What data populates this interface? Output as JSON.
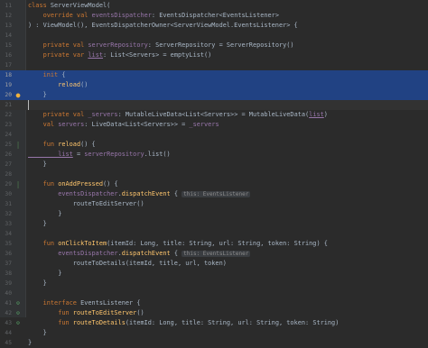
{
  "editor": {
    "lines": [
      {
        "num": "11",
        "mark": "",
        "sel": false,
        "tokens": [
          [
            "kw",
            "class "
          ],
          [
            "cl",
            "ServerViewModel"
          ],
          [
            "pl",
            "("
          ]
        ]
      },
      {
        "num": "12",
        "mark": "",
        "sel": false,
        "tokens": [
          [
            "kw",
            "    override val "
          ],
          [
            "pr",
            "eventsDispatcher"
          ],
          [
            "pl",
            ": EventsDispatcher<EventsListener>"
          ]
        ]
      },
      {
        "num": "13",
        "mark": "",
        "sel": false,
        "tokens": [
          [
            "pl",
            ") : ViewModel(), EventsDispatcherOwner<ServerViewModel.EventsListener> {"
          ]
        ]
      },
      {
        "num": "14",
        "mark": "",
        "sel": false,
        "tokens": []
      },
      {
        "num": "15",
        "mark": "",
        "sel": false,
        "tokens": [
          [
            "kw",
            "    private val "
          ],
          [
            "pr",
            "serverRepository"
          ],
          [
            "pl",
            ": ServerRepository = ServerRepository()"
          ]
        ]
      },
      {
        "num": "16",
        "mark": "",
        "sel": false,
        "tokens": [
          [
            "kw",
            "    private var "
          ],
          [
            "pr ul",
            "list"
          ],
          [
            "pl",
            ": List<Servers> = emptyList()"
          ]
        ]
      },
      {
        "num": "17",
        "mark": "",
        "sel": false,
        "tokens": []
      },
      {
        "num": "18",
        "mark": "",
        "sel": true,
        "tokens": [
          [
            "kw",
            "    init "
          ],
          [
            "pl",
            "{"
          ]
        ]
      },
      {
        "num": "19",
        "mark": "",
        "sel": true,
        "tokens": [
          [
            "fn",
            "        reload"
          ],
          [
            "pl",
            "()"
          ]
        ]
      },
      {
        "num": "20",
        "mark": "bulb",
        "sel": true,
        "tokens": [
          [
            "pl",
            "    }"
          ]
        ]
      },
      {
        "num": "21",
        "mark": "",
        "sel": false,
        "cur": true,
        "tokens": []
      },
      {
        "num": "22",
        "mark": "",
        "sel": false,
        "tokens": [
          [
            "kw",
            "    private val "
          ],
          [
            "pr",
            "_servers"
          ],
          [
            "pl",
            ": MutableLiveData<List<Servers>> = MutableLiveData("
          ],
          [
            "pr ul",
            "list"
          ],
          [
            "pl",
            ")"
          ]
        ]
      },
      {
        "num": "23",
        "mark": "",
        "sel": false,
        "tokens": [
          [
            "kw",
            "    val "
          ],
          [
            "pr",
            "servers"
          ],
          [
            "pl",
            ": LiveData<List<Servers>> = "
          ],
          [
            "pr",
            "_servers"
          ]
        ]
      },
      {
        "num": "24",
        "mark": "",
        "sel": false,
        "tokens": []
      },
      {
        "num": "25",
        "mark": "mod",
        "sel": false,
        "tokens": [
          [
            "kw",
            "    fun "
          ],
          [
            "fn",
            "reload"
          ],
          [
            "pl",
            "() {"
          ]
        ]
      },
      {
        "num": "26",
        "mark": "",
        "sel": false,
        "tokens": [
          [
            "pr ul",
            "        list"
          ],
          [
            "pl",
            " = "
          ],
          [
            "pr",
            "serverRepository"
          ],
          [
            "pl",
            ".list()"
          ]
        ]
      },
      {
        "num": "27",
        "mark": "",
        "sel": false,
        "tokens": [
          [
            "pl",
            "    }"
          ]
        ]
      },
      {
        "num": "28",
        "mark": "",
        "sel": false,
        "tokens": []
      },
      {
        "num": "29",
        "mark": "mod",
        "sel": false,
        "tokens": [
          [
            "kw",
            "    fun "
          ],
          [
            "fn",
            "onAddPressed"
          ],
          [
            "pl",
            "() {"
          ]
        ]
      },
      {
        "num": "30",
        "mark": "",
        "sel": false,
        "tokens": [
          [
            "pr",
            "        eventsDispatcher"
          ],
          [
            "pl",
            "."
          ],
          [
            "fn",
            "dispatchEvent"
          ],
          [
            "pl",
            " { "
          ],
          [
            "hint",
            "this: EventsListener"
          ]
        ]
      },
      {
        "num": "31",
        "mark": "",
        "sel": false,
        "tokens": [
          [
            "pl",
            "            routeToEditServer()"
          ]
        ]
      },
      {
        "num": "32",
        "mark": "",
        "sel": false,
        "tokens": [
          [
            "pl",
            "        }"
          ]
        ]
      },
      {
        "num": "33",
        "mark": "",
        "sel": false,
        "tokens": [
          [
            "pl",
            "    }"
          ]
        ]
      },
      {
        "num": "34",
        "mark": "",
        "sel": false,
        "tokens": []
      },
      {
        "num": "35",
        "mark": "",
        "sel": false,
        "tokens": [
          [
            "kw",
            "    fun "
          ],
          [
            "fn",
            "onClickToItem"
          ],
          [
            "pl",
            "(itemId: Long, title: String, url: String, token: String) {"
          ]
        ]
      },
      {
        "num": "36",
        "mark": "",
        "sel": false,
        "tokens": [
          [
            "pr",
            "        eventsDispatcher"
          ],
          [
            "pl",
            "."
          ],
          [
            "fn",
            "dispatchEvent"
          ],
          [
            "pl",
            " { "
          ],
          [
            "hint",
            "this: EventsListener"
          ]
        ]
      },
      {
        "num": "37",
        "mark": "",
        "sel": false,
        "tokens": [
          [
            "pl",
            "            routeToDetails(itemId, title, url, token)"
          ]
        ]
      },
      {
        "num": "38",
        "mark": "",
        "sel": false,
        "tokens": [
          [
            "pl",
            "        }"
          ]
        ]
      },
      {
        "num": "39",
        "mark": "",
        "sel": false,
        "tokens": [
          [
            "pl",
            "    }"
          ]
        ]
      },
      {
        "num": "40",
        "mark": "",
        "sel": false,
        "tokens": []
      },
      {
        "num": "41",
        "mark": "impl",
        "sel": false,
        "tokens": [
          [
            "kw",
            "    interface "
          ],
          [
            "cl",
            "EventsListener"
          ],
          [
            "pl",
            " {"
          ]
        ]
      },
      {
        "num": "42",
        "mark": "impl",
        "sel": false,
        "tokens": [
          [
            "kw",
            "        fun "
          ],
          [
            "fn",
            "routeToEditServer"
          ],
          [
            "pl",
            "()"
          ]
        ]
      },
      {
        "num": "43",
        "mark": "impl",
        "sel": false,
        "tokens": [
          [
            "kw",
            "        fun "
          ],
          [
            "fn",
            "routeToDetails"
          ],
          [
            "pl",
            "(itemId: Long, title: String, url: String, token: String)"
          ]
        ]
      },
      {
        "num": "44",
        "mark": "",
        "sel": false,
        "tokens": [
          [
            "pl",
            "    }"
          ]
        ]
      },
      {
        "num": "45",
        "mark": "",
        "sel": false,
        "tokens": [
          [
            "pl",
            "}"
          ]
        ]
      }
    ],
    "colors": {
      "background": "#2b2b2b",
      "gutter": "#313335",
      "selection": "#214283",
      "keyword": "#cc7832",
      "property": "#9876aa",
      "function": "#ffc66d",
      "plain": "#a9b7c6"
    },
    "icons": {
      "impl": "implemented-marker-icon",
      "bulb": "intention-bulb-icon",
      "mod": "modified-marker-icon"
    }
  }
}
